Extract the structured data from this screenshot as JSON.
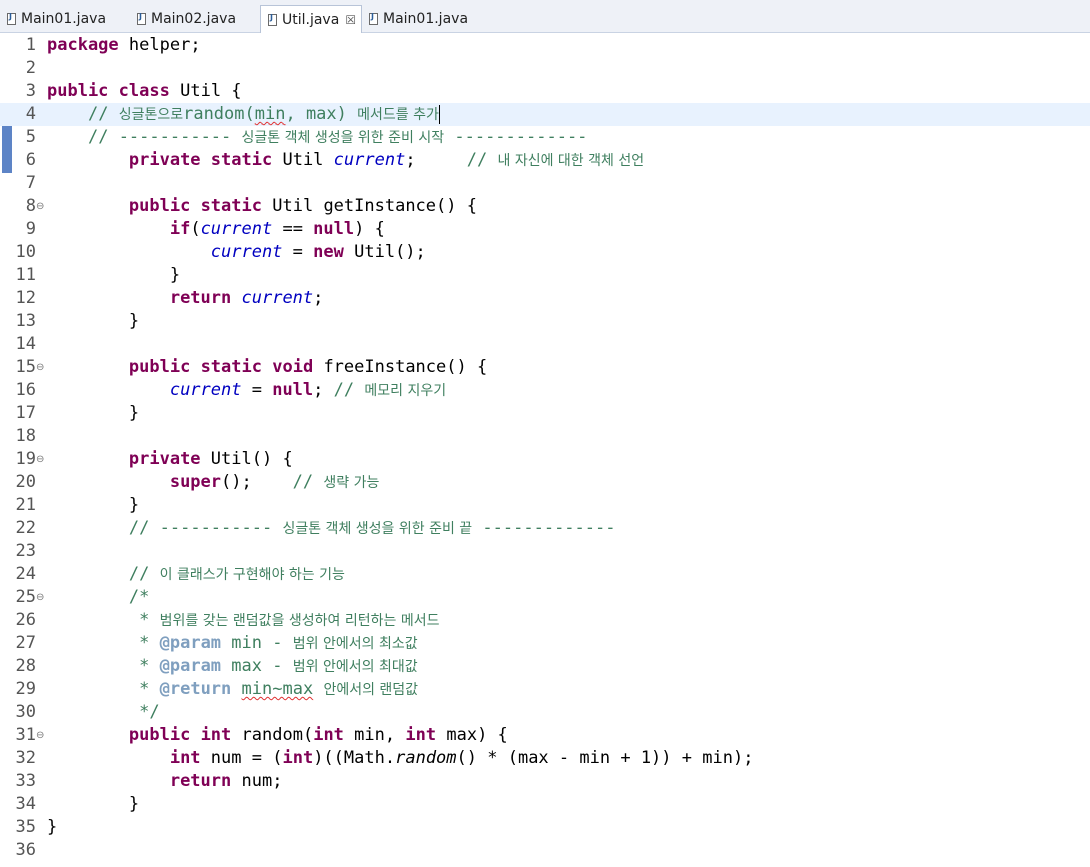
{
  "tabs": [
    {
      "label": "Main01.java",
      "active": false
    },
    {
      "label": "Main02.java",
      "active": false
    },
    {
      "label": "Util.java",
      "active": true,
      "close": "☒"
    },
    {
      "label": "Main01.java",
      "active": false
    }
  ],
  "lines": [
    {
      "n": "1"
    },
    {
      "n": "2"
    },
    {
      "n": "3"
    },
    {
      "n": "4"
    },
    {
      "n": "5"
    },
    {
      "n": "6"
    },
    {
      "n": "7"
    },
    {
      "n": "8",
      "fold": "⊖"
    },
    {
      "n": "9"
    },
    {
      "n": "10"
    },
    {
      "n": "11"
    },
    {
      "n": "12"
    },
    {
      "n": "13"
    },
    {
      "n": "14"
    },
    {
      "n": "15",
      "fold": "⊖"
    },
    {
      "n": "16"
    },
    {
      "n": "17"
    },
    {
      "n": "18"
    },
    {
      "n": "19",
      "fold": "⊖"
    },
    {
      "n": "20"
    },
    {
      "n": "21"
    },
    {
      "n": "22"
    },
    {
      "n": "23"
    },
    {
      "n": "24"
    },
    {
      "n": "25",
      "fold": "⊖"
    },
    {
      "n": "26"
    },
    {
      "n": "27"
    },
    {
      "n": "28"
    },
    {
      "n": "29"
    },
    {
      "n": "30"
    },
    {
      "n": "31",
      "fold": "⊖"
    },
    {
      "n": "32"
    },
    {
      "n": "33"
    },
    {
      "n": "34"
    },
    {
      "n": "35"
    },
    {
      "n": "36"
    }
  ],
  "code": {
    "kw_package": "package",
    "pkg_name": "helper",
    "kw_public": "public",
    "kw_class": "class",
    "kw_private": "private",
    "kw_static": "static",
    "kw_void": "void",
    "kw_if": "if",
    "kw_null": "null",
    "kw_new": "new",
    "kw_return": "return",
    "kw_super": "super",
    "kw_int": "int",
    "cls_util": "Util",
    "fld_current": "current",
    "m_getInstance": "getInstance",
    "m_freeInstance": "freeInstance",
    "m_random": "random",
    "p_min": "min",
    "p_max": "max",
    "v_num": "num",
    "math": "Math",
    "math_random": "random",
    "min_max": "min~max",
    "cm_slashes": "//",
    "cm_dashes": "-----------",
    "cm_dashes_end": "-------------",
    "c4_ko": "싱글톤으로",
    "c4_code": "random(min, max)",
    "c4_ko2": "메서드를 추가",
    "c5_ko": "싱글톤 객체 생성을 위한 준비 시작",
    "c6_ko": "내 자신에 대한 객체 선언",
    "c16_ko": "메모리 지우기",
    "c20_ko": "생략 가능",
    "c22_ko": "싱글톤 객체 생성을 위한 준비 끝",
    "c24_ko": "이 클래스가 구현해야 하는 기능",
    "jd_open": "/*",
    "jd_star": "*",
    "jd_close": "*/",
    "jd26_ko": "범위를 갖는 랜덤값을 생성하여 리턴하는 메서드",
    "tag_param": "@param",
    "tag_return": "@return",
    "jd27_ko": "범위 안에서의 최소값",
    "jd28_ko": "범위 안에서의 최대값",
    "jd29_ko": "안에서의 랜덤값",
    "dash": "-"
  },
  "colors": {
    "keyword": "#7f0055",
    "comment": "#3f7f5f",
    "field": "#0000c0",
    "javadoc_tag": "#7f9fbf",
    "current_line": "#e8f2fe"
  }
}
